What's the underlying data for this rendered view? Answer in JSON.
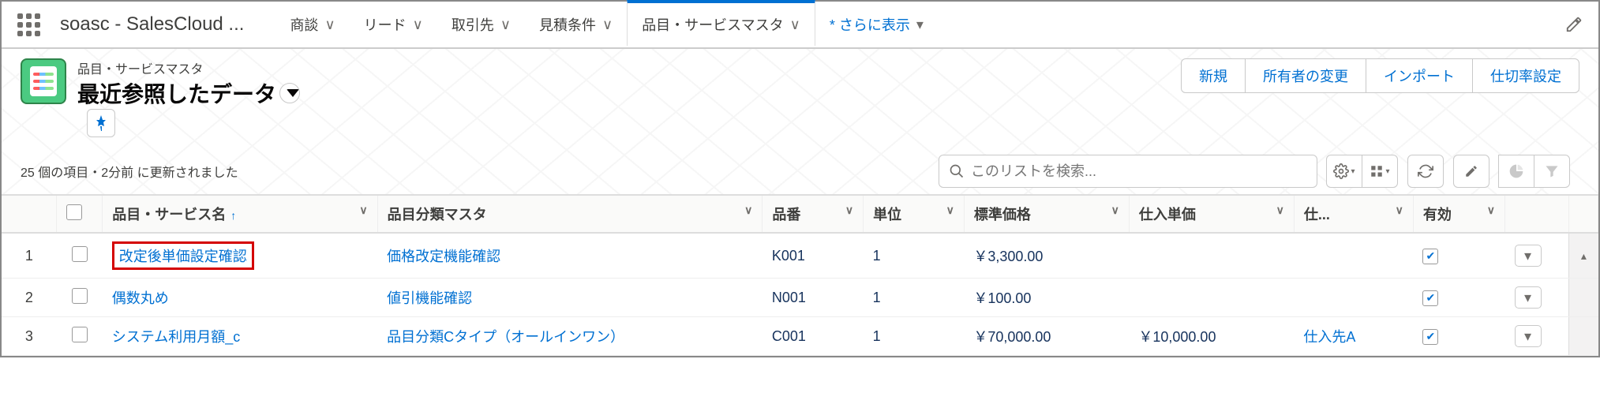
{
  "topbar": {
    "app_name": "soasc - SalesCloud ...",
    "nav": [
      {
        "label": "商談"
      },
      {
        "label": "リード"
      },
      {
        "label": "取引先"
      },
      {
        "label": "見積条件"
      },
      {
        "label": "品目・サービスマスタ",
        "active": true
      }
    ],
    "more_label": "* さらに表示"
  },
  "header": {
    "object_small": "品目・サービスマスタ",
    "list_title": "最近参照したデータ",
    "actions": [
      "新規",
      "所有者の変更",
      "インポート",
      "仕切率設定"
    ],
    "status": "25 個の項目・2分前 に更新されました",
    "search_placeholder": "このリストを検索..."
  },
  "columns": {
    "c1": "品目・サービス名",
    "c2": "品目分類マスタ",
    "c3": "品番",
    "c4": "単位",
    "c5": "標準価格",
    "c6": "仕入単価",
    "c7": "仕...",
    "c8": "有効"
  },
  "rows": [
    {
      "num": "1",
      "name": "改定後単価設定確認",
      "cat": "価格改定機能確認",
      "ban": "K001",
      "unit": "1",
      "std": "￥3,300.00",
      "cost": "",
      "sup": "",
      "valid": true,
      "highlight": true
    },
    {
      "num": "2",
      "name": "偶数丸め",
      "cat": "値引機能確認",
      "ban": "N001",
      "unit": "1",
      "std": "￥100.00",
      "cost": "",
      "sup": "",
      "valid": true
    },
    {
      "num": "3",
      "name": "システム利用月額_c",
      "cat": "品目分類Cタイプ（オールインワン）",
      "ban": "C001",
      "unit": "1",
      "std": "￥70,000.00",
      "cost": "￥10,000.00",
      "sup": "仕入先A",
      "valid": true
    }
  ]
}
